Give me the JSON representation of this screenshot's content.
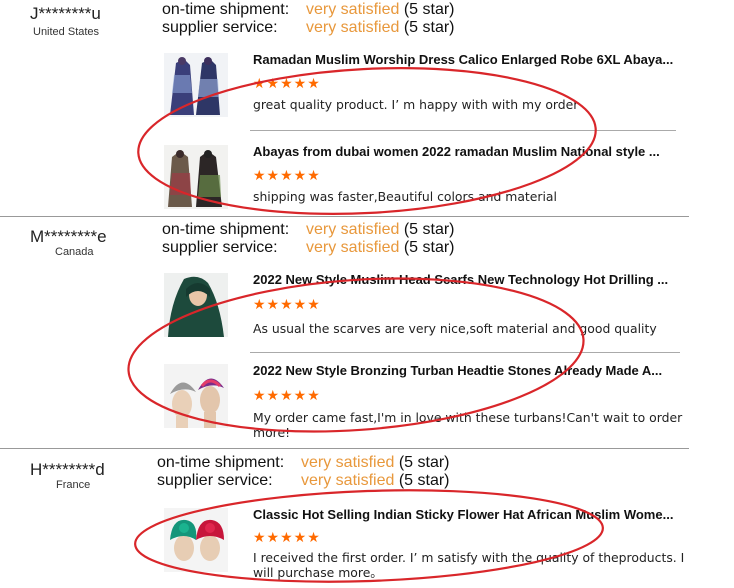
{
  "reviews": [
    {
      "buyer": "J********u",
      "country": "United States",
      "shipment_label": "on-time shipment:",
      "shipment_value": "very satisfied",
      "shipment_star": "(5 star)",
      "supplier_label": "supplier service:",
      "supplier_value": "very satisfied",
      "supplier_star": "(5 star)",
      "items": [
        {
          "title": "Ramadan Muslim Worship Dress Calico Enlarged Robe 6XL Abaya...",
          "stars": "★★★★★",
          "comment": "great quality product. I’  m happy with with my order"
        },
        {
          "title": "Abayas from dubai women 2022 ramadan Muslim National style ...",
          "stars": "★★★★★",
          "comment": "shipping was faster,Beautiful colors and material"
        }
      ]
    },
    {
      "buyer": "M********e",
      "country": "Canada",
      "shipment_label": "on-time shipment:",
      "shipment_value": "very satisfied",
      "shipment_star": "(5 star)",
      "supplier_label": "supplier service:",
      "supplier_value": "very satisfied",
      "supplier_star": "(5 star)",
      "items": [
        {
          "title": "2022 New Style Muslim Head Scarfs New Technology Hot Drilling ...",
          "stars": "★★★★★",
          "comment": "As usual the scarves are very nice,soft material and good quality"
        },
        {
          "title": "2022 New Style Bronzing Turban Headtie Stones Already Made A...",
          "stars": "★★★★★",
          "comment": "My order came fast,I'm in love with these turbans!Can't wait to order more!"
        }
      ]
    },
    {
      "buyer": "H********d",
      "country": "France",
      "shipment_label": "on-time shipment:",
      "shipment_value": "very satisfied",
      "shipment_star": "(5 star)",
      "supplier_label": "supplier service:",
      "supplier_value": "very satisfied",
      "supplier_star": "(5 star)",
      "items": [
        {
          "title": "Classic Hot Selling Indian Sticky Flower Hat African Muslim Wome...",
          "stars": "★★★★★",
          "comment": "I received the first order. I’  m satisfy with the quality of theproducts. I will purchase more。"
        }
      ]
    }
  ],
  "colors": {
    "satisfied": "#e8983c",
    "stars": "#ff6a00",
    "annotation": "#d9262a"
  }
}
